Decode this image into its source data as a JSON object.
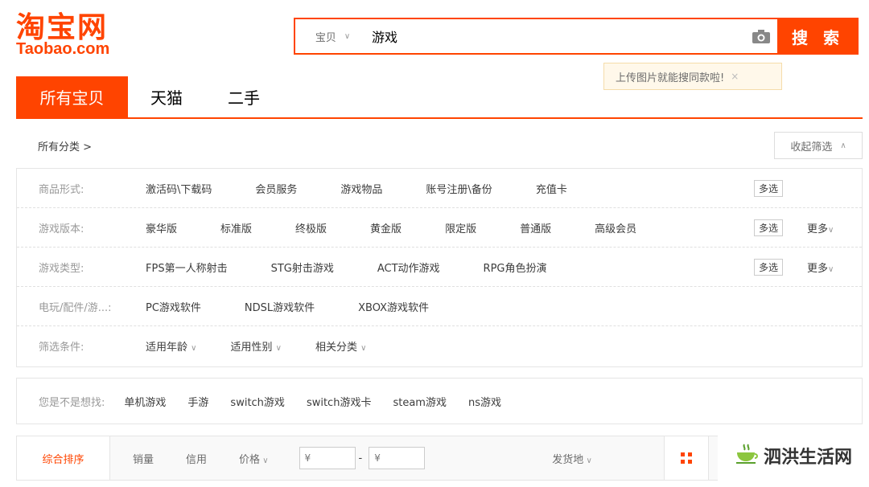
{
  "logo": {
    "cn": "淘宝网",
    "en": "Taobao.com"
  },
  "search": {
    "type_label": "宝贝",
    "query": "游戏",
    "camera_icon": "camera-icon",
    "button_label": "搜 索",
    "tip": "上传图片就能搜同款啦!",
    "tip_close": "×"
  },
  "tabs": [
    {
      "label": "所有宝贝",
      "active": true
    },
    {
      "label": "天猫",
      "active": false
    },
    {
      "label": "二手",
      "active": false
    }
  ],
  "crumb": {
    "all": "所有分类 >",
    "collapse": "收起筛选"
  },
  "filters": {
    "form": {
      "label": "商品形式:",
      "options": [
        "激活码\\下载码",
        "会员服务",
        "游戏物品",
        "账号注册\\备份",
        "充值卡"
      ],
      "multi": "多选"
    },
    "edition": {
      "label": "游戏版本:",
      "options": [
        "豪华版",
        "标准版",
        "终极版",
        "黄金版",
        "限定版",
        "普通版",
        "高级会员"
      ],
      "multi": "多选",
      "more": "更多"
    },
    "genre": {
      "label": "游戏类型:",
      "options": [
        "FPS第一人称射击",
        "STG射击游戏",
        "ACT动作游戏",
        "RPG角色扮演"
      ],
      "multi": "多选",
      "more": "更多"
    },
    "platform": {
      "label": "电玩/配件/游...:",
      "options": [
        "PC游戏软件",
        "NDSL游戏软件",
        "XBOX游戏软件"
      ]
    },
    "conditions": {
      "label": "筛选条件:",
      "options": [
        "适用年龄",
        "适用性别",
        "相关分类"
      ]
    }
  },
  "suggest": {
    "label": "您是不是想找:",
    "items": [
      "单机游戏",
      "手游",
      "switch游戏",
      "switch游戏卡",
      "steam游戏",
      "ns游戏"
    ]
  },
  "sortbar": {
    "default": "综合排序",
    "sales": "销量",
    "credit": "信用",
    "price": "价格",
    "price_min_placeholder": "¥",
    "price_max_placeholder": "¥",
    "dash": "-",
    "location": "发货地"
  },
  "watermark": {
    "text": "泗洪生活网"
  },
  "colors": {
    "accent": "#ff4400",
    "tip_bg": "#fff8ea",
    "muted": "#999999"
  }
}
